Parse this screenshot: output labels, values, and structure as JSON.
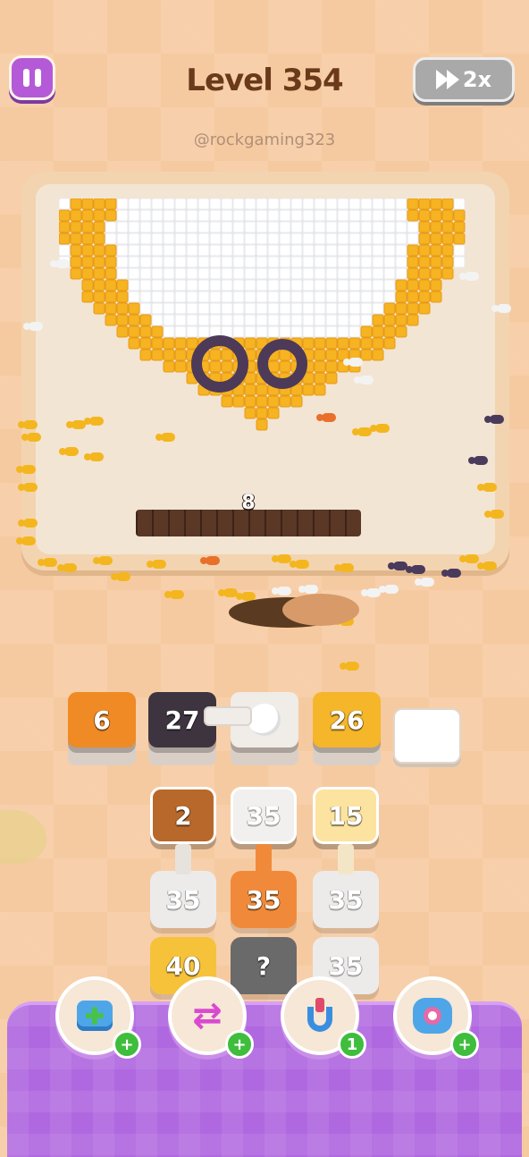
{
  "header": {
    "level_title": "Level 354",
    "watermark": "@rockgaming323",
    "speed_label": "2x"
  },
  "board": {
    "chocolate_count": "8"
  },
  "queue_slots": [
    {
      "value": "6",
      "color": "#f08a24"
    },
    {
      "value": "27",
      "color": "#3d3440"
    },
    {
      "value": "",
      "color": "#f0ece8",
      "state": "pipe-connector"
    },
    {
      "value": "26",
      "color": "#f6b62a"
    },
    {
      "value": "",
      "color": "#ffffff",
      "state": "empty"
    }
  ],
  "grid": {
    "row1": [
      {
        "value": "2",
        "color": "#b8682a"
      },
      {
        "value": "35",
        "color": "#f2f0ee"
      },
      {
        "value": "15",
        "color": "#fde3a0"
      }
    ],
    "row2": [
      {
        "value": "35",
        "color": "#ecebea"
      },
      {
        "value": "35",
        "color": "#f08a3a"
      },
      {
        "value": "35",
        "color": "#ecebea"
      }
    ],
    "row3": [
      {
        "value": "40",
        "color": "#f6c23a"
      },
      {
        "value": "?",
        "color": "#6a6a6a"
      },
      {
        "value": "35",
        "color": "#ecebea"
      }
    ]
  },
  "boosters": [
    {
      "icon": "add-box-icon",
      "badge": "+"
    },
    {
      "icon": "swap-arrows-icon",
      "badge": "+"
    },
    {
      "icon": "magnet-claw-icon",
      "badge": "1"
    },
    {
      "icon": "donut-block-icon",
      "badge": "+"
    }
  ]
}
